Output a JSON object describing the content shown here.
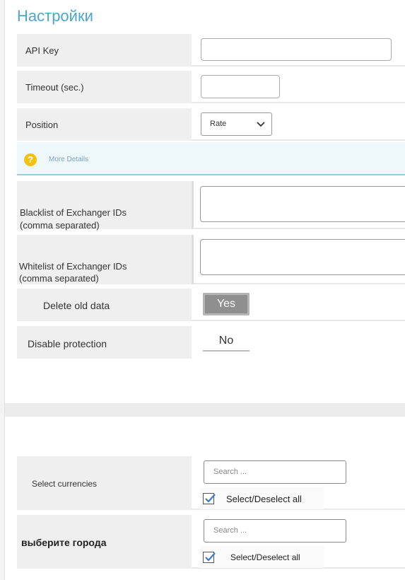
{
  "title": "Настройки",
  "fields": {
    "api_key": {
      "label": "API Key",
      "value": ""
    },
    "timeout": {
      "label": "Timeout (sec.)",
      "value": ""
    },
    "position": {
      "label": "Position",
      "selected": "Rate"
    },
    "info": {
      "text": "More Details"
    },
    "blacklist": {
      "label_line1": "Blacklist of Exchanger IDs",
      "label_line2": "(comma separated)",
      "value": ""
    },
    "whitelist": {
      "label_line1": "Whitelist of Exchanger IDs",
      "label_line2": "(comma separated)",
      "value": ""
    },
    "delete_old": {
      "label": "Delete old data",
      "value": "Yes"
    },
    "disable_protection": {
      "label": "Disable protection",
      "value": "No"
    }
  },
  "filters": {
    "currencies": {
      "label": "Select currencies",
      "search_placeholder": "Search ...",
      "select_all": "Select/Deselect all",
      "checked": true
    },
    "cities": {
      "label": "выберите города",
      "search_placeholder": "Search ...",
      "select_all": "Select/Deselect all",
      "checked": true
    }
  },
  "colors": {
    "title": "#4aa7c9",
    "icon": "#f4c20d",
    "checkmark": "#3a7bd5"
  }
}
